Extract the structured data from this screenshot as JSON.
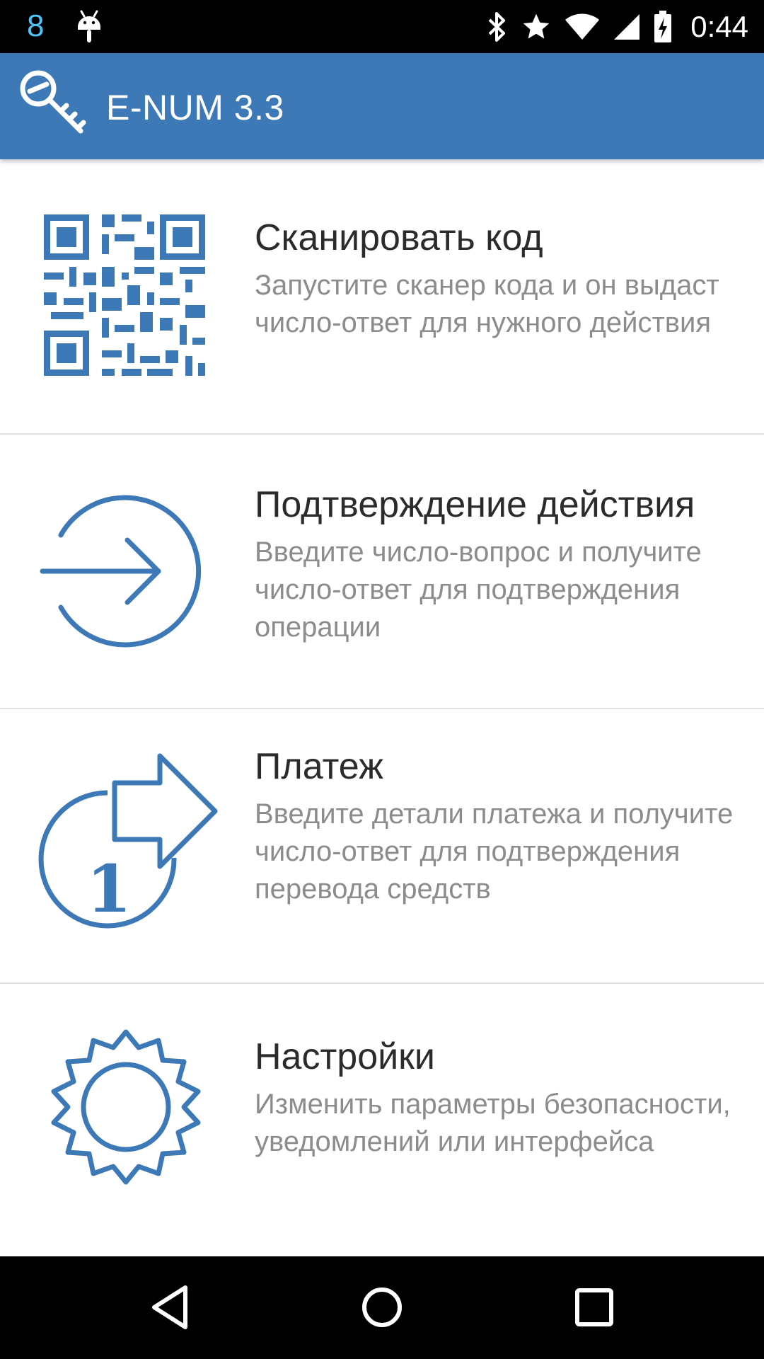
{
  "status_bar": {
    "notification_count": "8",
    "time": "0:44",
    "icons": [
      "android-icon",
      "bluetooth-icon",
      "star-icon",
      "wifi-icon",
      "signal-icon",
      "battery-icon"
    ]
  },
  "app_bar": {
    "title": "E-NUM 3.3",
    "logo_icon": "key-logo-icon"
  },
  "menu": {
    "items": [
      {
        "title": "Сканировать код",
        "description": "Запустите сканер кода и он выдаст число-ответ для нужного действия",
        "icon": "qr-code-icon"
      },
      {
        "title": "Подтверждение действия",
        "description": "Введите число-вопрос и получите число-ответ для подтверждения операции",
        "icon": "sign-in-icon"
      },
      {
        "title": "Платеж",
        "description": "Введите детали платежа и получите число-ответ для подтверждения перевода средств",
        "icon": "payment-icon"
      },
      {
        "title": "Настройки",
        "description": "Изменить параметры безопасности, уведомлений или интерфейса",
        "icon": "gear-icon"
      }
    ]
  },
  "nav_bar": {
    "buttons": [
      "back-icon",
      "home-icon",
      "recents-icon"
    ]
  },
  "colors": {
    "accent": "#3d79b7",
    "title_text": "#2b2b2b",
    "description_text": "#8c8c8c"
  }
}
